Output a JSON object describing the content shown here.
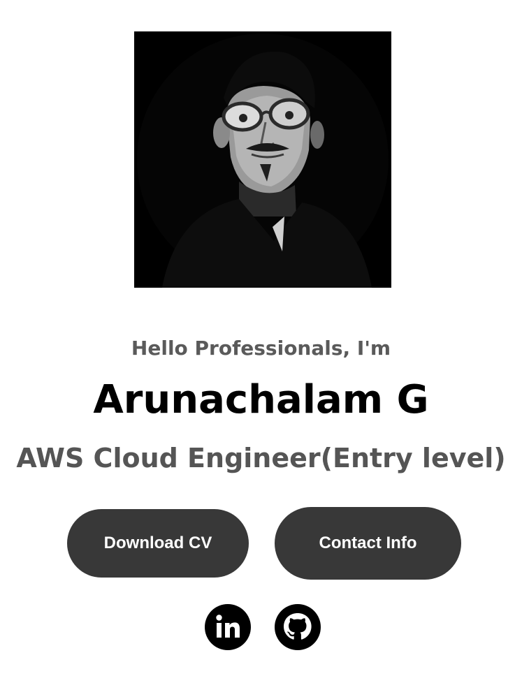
{
  "profile": {
    "photo_alt": "profile-photo",
    "greeting": "Hello Professionals, I'm",
    "name": "Arunachalam G",
    "role": "AWS Cloud Engineer(Entry level)"
  },
  "actions": {
    "download_cv_label": "Download CV",
    "contact_info_label": "Contact Info"
  },
  "social": [
    {
      "icon": "linkedin-icon"
    },
    {
      "icon": "github-icon"
    }
  ],
  "colors": {
    "button_bg": "#383838",
    "button_text": "#ffffff",
    "name_text": "#000000",
    "greeting_text": "#5a5a5a",
    "role_text": "#555555"
  }
}
